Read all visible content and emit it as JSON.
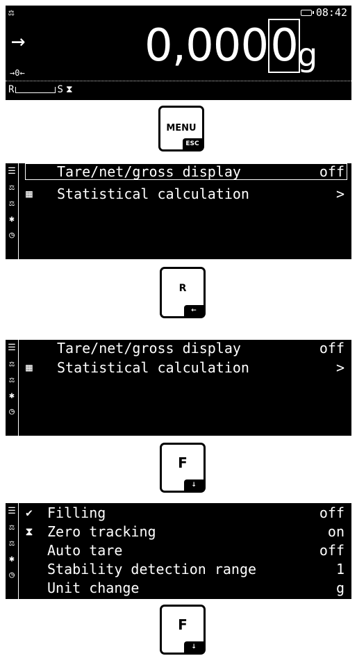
{
  "screen1": {
    "time": "08:42",
    "arrow": "→",
    "reading_main": "0,000",
    "reading_last": "0",
    "unit": "g",
    "zero_label": "→0←",
    "status_r": "R",
    "status_s": "S",
    "icons": [
      "balance-icon",
      "battery-icon",
      "hourglass-icon"
    ]
  },
  "keys": {
    "menu": {
      "main": "MENU",
      "sub": "ESC"
    },
    "r": {
      "main": "R",
      "sub": "←"
    },
    "f1": {
      "main": "F",
      "sub": "↓"
    },
    "f2": {
      "main": "F",
      "sub": "↓"
    }
  },
  "screen2": {
    "side_icons": [
      "list-icon",
      "balance-icon",
      "balance-settings-icon",
      "gear-icon",
      "clock-icon"
    ],
    "rows": [
      {
        "label": "Tare/net/gross display",
        "value": "off"
      },
      {
        "label": "Statistical calculation",
        "value": ">"
      }
    ]
  },
  "screen3": {
    "side_icons": [
      "list-icon",
      "balance-icon",
      "balance-settings-icon",
      "gear-icon",
      "clock-icon"
    ],
    "rows": [
      {
        "label": "Tare/net/gross display",
        "value": "off"
      },
      {
        "label": "Statistical calculation",
        "value": ">"
      }
    ]
  },
  "screen4": {
    "side_icons": [
      "list-icon",
      "balance-icon",
      "balance-settings-icon",
      "gear-icon",
      "clock-icon"
    ],
    "rows": [
      {
        "label": "Filling",
        "value": "off"
      },
      {
        "label": "Zero tracking",
        "value": "on"
      },
      {
        "label": "Auto tare",
        "value": "off"
      },
      {
        "label": "Stability detection range",
        "value": "1"
      },
      {
        "label": "Unit change",
        "value": "g"
      }
    ]
  }
}
